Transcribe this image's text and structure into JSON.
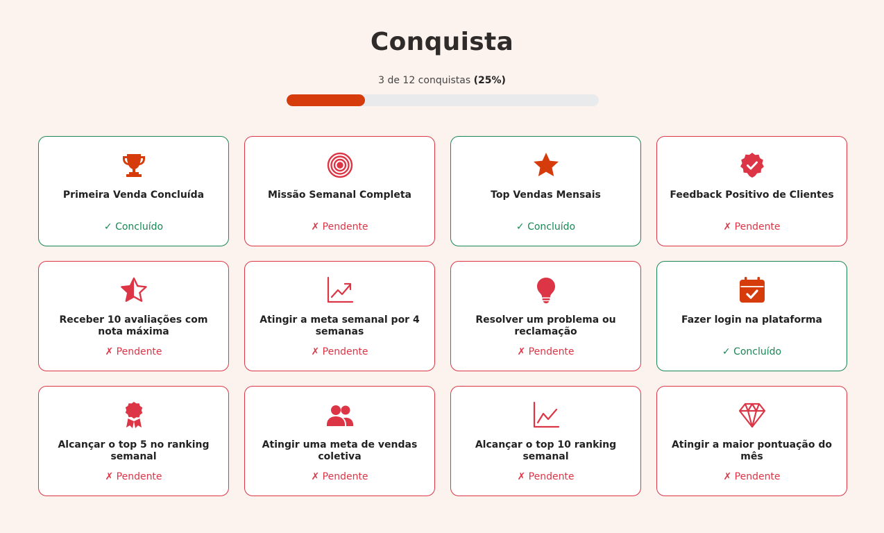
{
  "header": {
    "title": "Conquista",
    "progress_prefix": "3 de 12 conquistas ",
    "progress_percent_label": "(25%)",
    "progress_fraction": 0.25
  },
  "colors": {
    "background": "#fdf3ee",
    "accent": "#d63b0c",
    "done": "#198754",
    "pending": "#dc3545"
  },
  "achievements": [
    {
      "label": "Primeira Venda Concluída",
      "status": "✓ Concluído",
      "done": true,
      "icon": "trophy-icon"
    },
    {
      "label": "Missão Semanal Completa",
      "status": "✗ Pendente",
      "done": false,
      "icon": "target-icon"
    },
    {
      "label": "Top Vendas Mensais",
      "status": "✓ Concluído",
      "done": true,
      "icon": "star-icon"
    },
    {
      "label": "Feedback Positivo de Clientes",
      "status": "✗ Pendente",
      "done": false,
      "icon": "verified-badge-icon"
    },
    {
      "label": "Receber 10 avaliações com nota máxima",
      "status": "✗ Pendente",
      "done": false,
      "icon": "half-star-icon"
    },
    {
      "label": "Atingir a meta semanal por 4 semanas",
      "status": "✗ Pendente",
      "done": false,
      "icon": "graph-up-arrow-icon"
    },
    {
      "label": "Resolver um problema ou reclamação",
      "status": "✗ Pendente",
      "done": false,
      "icon": "lightbulb-icon"
    },
    {
      "label": "Fazer login na plataforma",
      "status": "✓ Concluído",
      "done": true,
      "icon": "calendar-check-icon"
    },
    {
      "label": "Alcançar o top 5 no ranking semanal",
      "status": "✗ Pendente",
      "done": false,
      "icon": "award-icon"
    },
    {
      "label": "Atingir uma meta de vendas coletiva",
      "status": "✗ Pendente",
      "done": false,
      "icon": "people-icon"
    },
    {
      "label": "Alcançar o top 10 ranking semanal",
      "status": "✗ Pendente",
      "done": false,
      "icon": "graph-up-icon"
    },
    {
      "label": "Atingir a maior pontuação do mês",
      "status": "✗ Pendente",
      "done": false,
      "icon": "gem-icon"
    }
  ]
}
